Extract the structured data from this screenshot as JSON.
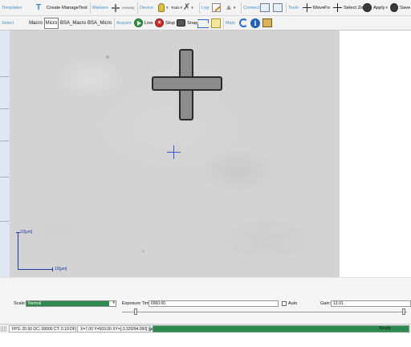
{
  "toolbar_top": {
    "groups": {
      "templates": "Templates",
      "markers": "Markers",
      "device": "Device",
      "log": "Log",
      "connect": "Connect",
      "tools": "Tools"
    },
    "buttons": {
      "create": "Create",
      "manage": "Manage",
      "test": "Test",
      "oneway": "oneway",
      "tools": "Tools",
      "movefo": "MoveFo",
      "select_zero": "Select Zero",
      "apply": "Apply",
      "save": "Save"
    }
  },
  "toolbar_bottom": {
    "groups": {
      "select": "Select",
      "acquire": "Acquire",
      "main": "Main"
    },
    "buttons": {
      "macro": "Macro",
      "micro": "Micro",
      "bsa_macro": "BSA_Macro",
      "bsa_micro": "BSA_Micro",
      "live": "Live",
      "stop": "Stop",
      "snap": "Snap"
    },
    "active_button": "Micro"
  },
  "viewer": {
    "scale_vertical_label": "10[µm]",
    "scale_horizontal_label": "10[µm]"
  },
  "controls": {
    "scale_label": "Scale:",
    "scale_value": "Normal",
    "exposure_label": "Exposure Time:",
    "exposure_value": "6960.00",
    "auto_label": "Auto",
    "auto_checked": false,
    "gain_label": "Gain:",
    "gain_value": "13.01"
  },
  "statusbar": {
    "fps": "FPS: 20.50 OC: 00000 CT: 0.19 DF: 0000",
    "coords": "X=7.00 Y=503.00 XY=[-3.320/94.050] [µm]",
    "status": "Ready",
    "progress_fraction": 1.0
  },
  "colors": {
    "accent_blue": "#4a90c8",
    "progress_green": "#2d8a4e",
    "scale_bar": "#1f3aa0",
    "crosshair": "#3a5bd0"
  }
}
